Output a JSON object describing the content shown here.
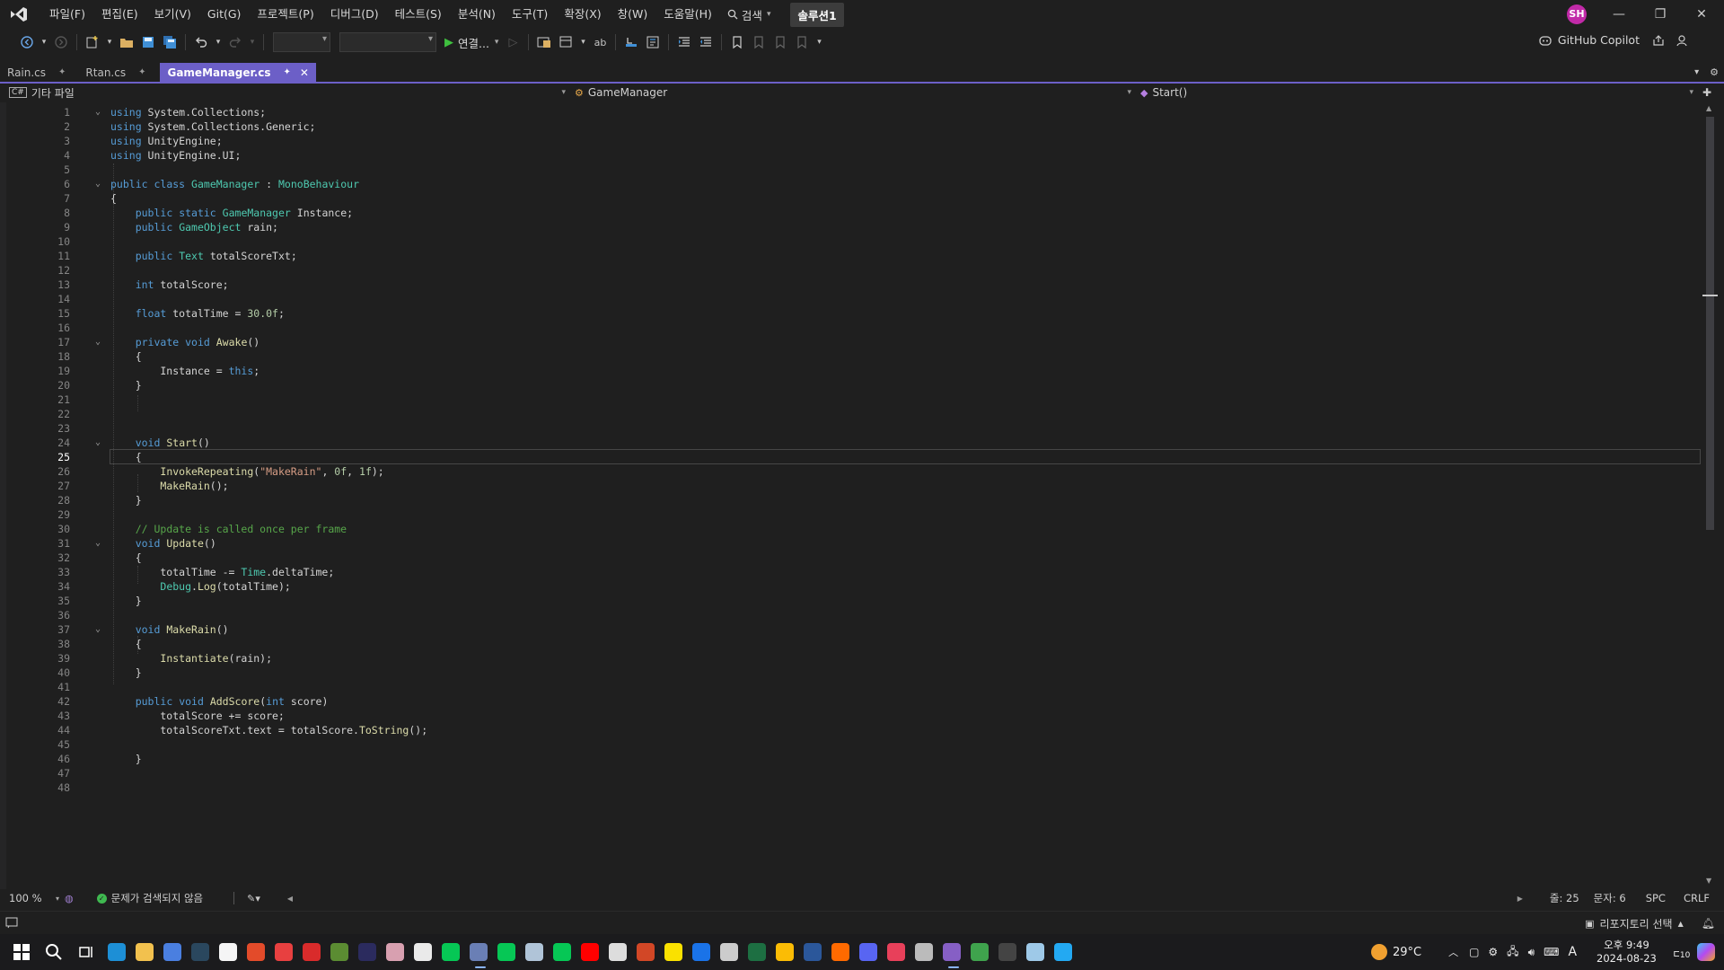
{
  "menubar": {
    "items": [
      "파일(F)",
      "편집(E)",
      "보기(V)",
      "Git(G)",
      "프로젝트(P)",
      "디버그(D)",
      "테스트(S)",
      "분석(N)",
      "도구(T)",
      "확장(X)",
      "창(W)",
      "도움말(H)"
    ],
    "search_label": "검색",
    "solution_name": "솔루션1",
    "avatar_initials": "SH"
  },
  "toolbar": {
    "run_label": "연결...",
    "copilot_label": "GitHub Copilot"
  },
  "tabs": [
    {
      "label": "Rain.cs",
      "active": false
    },
    {
      "label": "Rtan.cs",
      "active": false
    },
    {
      "label": "GameManager.cs",
      "active": true
    }
  ],
  "navbar": {
    "project": "기타 파일",
    "class": "GameManager",
    "member": "Start()"
  },
  "editor": {
    "current_line": 25,
    "lines": [
      "using System.Collections;",
      "using System.Collections.Generic;",
      "using UnityEngine;",
      "using UnityEngine.UI;",
      "",
      "public class GameManager : MonoBehaviour",
      "{",
      "    public static GameManager Instance;",
      "    public GameObject rain;",
      "",
      "    public Text totalScoreTxt;",
      "",
      "    int totalScore;",
      "",
      "    float totalTime = 30.0f;",
      "",
      "    private void Awake()",
      "    {",
      "        Instance = this;",
      "    }",
      "",
      "",
      "",
      "    void Start()",
      "    {",
      "        InvokeRepeating(\"MakeRain\", 0f, 1f);",
      "        MakeRain();",
      "    }",
      "",
      "    // Update is called once per frame",
      "    void Update()",
      "    {",
      "        totalTime -= Time.deltaTime;",
      "        Debug.Log(totalTime);",
      "    }",
      "",
      "    void MakeRain()",
      "    {",
      "        Instantiate(rain);",
      "    }",
      "",
      "    public void AddScore(int score)",
      "        totalScore += score;",
      "        totalScoreTxt.text = totalScore.ToString();",
      "",
      "    }",
      "",
      ""
    ],
    "fold_lines": [
      1,
      6,
      17,
      24,
      31,
      37
    ]
  },
  "editor_status": {
    "zoom": "100 %",
    "issues": "문제가 검색되지 않음",
    "line": "줄: 25",
    "char": "문자: 6",
    "spacing": "SPC",
    "line_ending": "CRLF"
  },
  "statusbar": {
    "repo_label": "리포지토리 선택"
  },
  "taskbar": {
    "weather": "29°C",
    "time": "오후 9:49",
    "date": "2024-08-23",
    "notification_count": "10",
    "ime": "A"
  },
  "colors": {
    "accent": "#6c5fc7",
    "background": "#1f1f1f",
    "keyword": "#569cd6",
    "type": "#4ec9b0",
    "method": "#dcdcaa",
    "string": "#d69d85",
    "comment": "#57a64a"
  }
}
